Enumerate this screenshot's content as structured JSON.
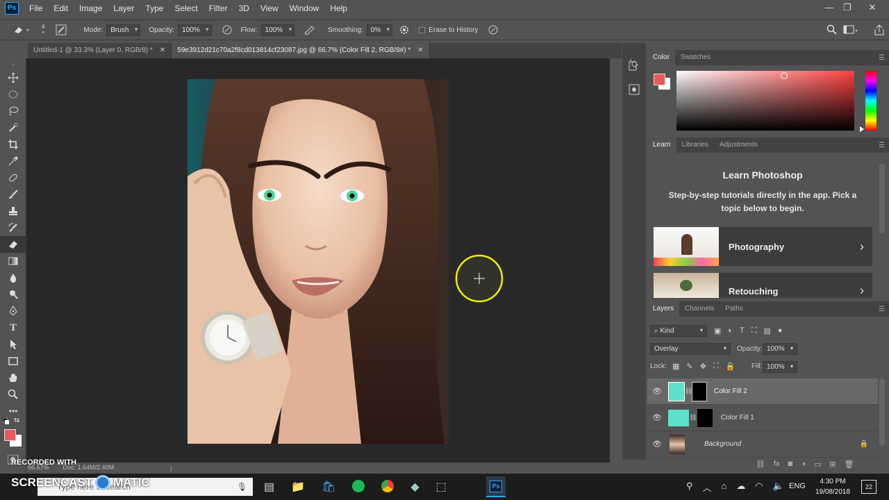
{
  "app": {
    "logo": "Ps"
  },
  "menu": [
    "File",
    "Edit",
    "Image",
    "Layer",
    "Type",
    "Select",
    "Filter",
    "3D",
    "View",
    "Window",
    "Help"
  ],
  "window_controls": {
    "minimize": "—",
    "restore": "❐",
    "close": "✕"
  },
  "options": {
    "mode_label": "Mode:",
    "mode_value": "Brush",
    "opacity_label": "Opacity:",
    "opacity_value": "100%",
    "flow_label": "Flow:",
    "flow_value": "100%",
    "smoothing_label": "Smoothing:",
    "smoothing_value": "0%",
    "erase_history_label": "Erase to History",
    "brush_size": "4"
  },
  "tabs": [
    {
      "label": "Untitled-1 @ 33.3% (Layer 0, RGB/8) *"
    },
    {
      "label": "59e3912d21c70a2f8cd013814cf23087.jpg @ 66.7% (Color Fill 2, RGB/8#) *"
    }
  ],
  "colors": {
    "foreground": "#e85a5a",
    "background": "#ffffff",
    "accent": "#31a8ff",
    "layer_fill": "#5fe0cc"
  },
  "color_panel": {
    "tabs": [
      "Color",
      "Swatches"
    ]
  },
  "learn_panel": {
    "tabs": [
      "Learn",
      "Libraries",
      "Adjustments"
    ],
    "title": "Learn Photoshop",
    "description": "Step-by-step tutorials directly in the app. Pick a topic below to begin.",
    "topics": [
      {
        "label": "Photography"
      },
      {
        "label": "Retouching"
      }
    ]
  },
  "layers_panel": {
    "tabs": [
      "Layers",
      "Channels",
      "Paths"
    ],
    "kind_label": "Kind",
    "blend_mode": "Overlay",
    "opacity_label": "Opacity:",
    "opacity_value": "100%",
    "lock_label": "Lock:",
    "fill_label": "Fill:",
    "fill_value": "100%",
    "layers": [
      {
        "name": "Color Fill 2",
        "selected": true
      },
      {
        "name": "Color Fill 1",
        "selected": false
      },
      {
        "name": "Background",
        "selected": false
      }
    ]
  },
  "status": {
    "zoom": "66.67%",
    "doc": "Doc: 1.64M/2.40M"
  },
  "watermark": {
    "recorded": "RECORDED WITH",
    "brand": "SCREENCAST",
    "brand2": "MATIC"
  },
  "taskbar": {
    "search_placeholder": "Type here to search",
    "language": "ENG",
    "time": "4:30 PM",
    "date": "19/08/2018",
    "notifications": "22"
  }
}
